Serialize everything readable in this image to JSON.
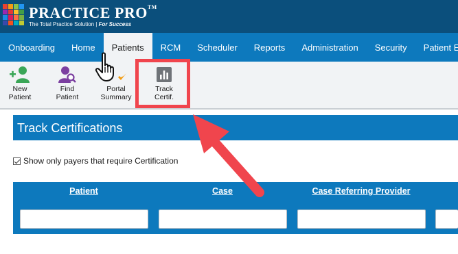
{
  "header": {
    "brand": "PRACTICE PRO",
    "trademark": "TM",
    "tagline_main": "The Total Practice Solution |",
    "tagline_em": "For Success",
    "logo_colors": [
      "#e8412f",
      "#f39c12",
      "#8bc34a",
      "#2196f3",
      "#9c27b0",
      "#e53935",
      "#fbc02d",
      "#43a047",
      "#1e88e5",
      "#d81b60",
      "#ff7043",
      "#7cb342",
      "#3949ab",
      "#f4511e",
      "#00acc1",
      "#c0ca33"
    ]
  },
  "nav": {
    "items": [
      "Onboarding",
      "Home",
      "Patients",
      "RCM",
      "Scheduler",
      "Reports",
      "Administration",
      "Security",
      "Patient Eng"
    ],
    "active": "Patients"
  },
  "toolbar": {
    "new_patient": "New\nPatient",
    "find_patient": "Find\nPatient",
    "portal_summary": "Portal\nSummary",
    "track_certif": "Track\nCertif."
  },
  "page": {
    "title": "Track Certifications",
    "checkbox_label": "Show only payers that require Certification",
    "checkbox_checked": true
  },
  "table": {
    "columns": [
      "Patient",
      "Case",
      "Case Referring Provider"
    ]
  },
  "colors": {
    "header_bg": "#0b4f7c",
    "nav_bg": "#0d79bd",
    "accent_green": "#3aa657",
    "accent_purple": "#7b3fa0",
    "highlight_red": "#f0454d"
  }
}
